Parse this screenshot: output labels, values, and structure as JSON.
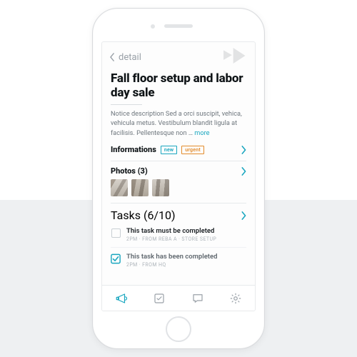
{
  "colors": {
    "accent": "#18a6bf",
    "warn": "#e38b2b",
    "muted": "#9aa1a8"
  },
  "nav": {
    "back_label": "detail"
  },
  "page": {
    "title": "Fall floor setup and labor day sale",
    "description": "Notice description Sed a orci suscipit, vehica, vehicula metus. Vestibulum blandit ligula at facilisis. Pellentesque non … ",
    "more_label": "more"
  },
  "sections": {
    "info": {
      "label": "Informations",
      "badges": [
        "new",
        "urgent"
      ]
    },
    "photos": {
      "label": "Photos (3)",
      "count": 3
    },
    "tasks": {
      "label": "Tasks (6/10)",
      "done": 6,
      "total": 10
    }
  },
  "tasks": [
    {
      "done": false,
      "title": "This task must be completed",
      "meta": "2PM · FROM REBA A · STORE SETUP"
    },
    {
      "done": true,
      "title": "This task has been completed",
      "meta": "2PM · FROM HQ"
    }
  ],
  "tabbar": {
    "items": [
      {
        "name": "announce",
        "active": true
      },
      {
        "name": "tasks",
        "active": false
      },
      {
        "name": "chat",
        "active": false
      },
      {
        "name": "settings",
        "active": false
      }
    ]
  }
}
